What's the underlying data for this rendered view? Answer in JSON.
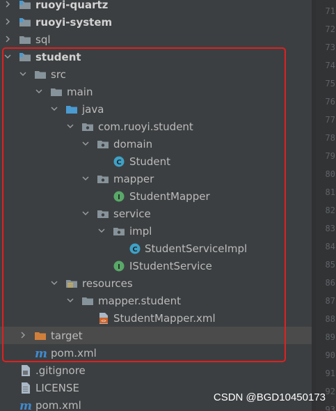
{
  "tree": {
    "items": [
      {
        "label": "ruoyi-quartz",
        "bold": true
      },
      {
        "label": "ruoyi-system",
        "bold": true
      },
      {
        "label": "sql"
      },
      {
        "label": "student",
        "bold": true
      },
      {
        "label": "src"
      },
      {
        "label": "main"
      },
      {
        "label": "java"
      },
      {
        "label": "com.ruoyi.student"
      },
      {
        "label": "domain"
      },
      {
        "label": "Student"
      },
      {
        "label": "mapper"
      },
      {
        "label": "StudentMapper"
      },
      {
        "label": "service"
      },
      {
        "label": "impl"
      },
      {
        "label": "StudentServiceImpl"
      },
      {
        "label": "IStudentService"
      },
      {
        "label": "resources"
      },
      {
        "label": "mapper.student"
      },
      {
        "label": "StudentMapper.xml"
      },
      {
        "label": "target"
      },
      {
        "label": "pom.xml"
      },
      {
        "label": ".gitignore"
      },
      {
        "label": "LICENSE"
      },
      {
        "label": "pom.xml"
      }
    ]
  },
  "gutter": {
    "line_numbers": [
      "71",
      "72",
      "73",
      "74",
      "75",
      "76",
      "77",
      "78",
      "79",
      "80",
      "81",
      "82",
      "83",
      "84",
      "85",
      "86",
      "87",
      "88",
      "89",
      "90",
      "91",
      "92",
      "93"
    ]
  },
  "watermark": "CSDN @BGD10450173",
  "colors": {
    "background": "#3c3f41",
    "text": "#bbbbbb",
    "folder": "#87939a",
    "source_folder": "#4a9bd1",
    "excluded_folder": "#d07f3b",
    "class_icon": "#3fa1c6",
    "interface_icon": "#59a869",
    "maven_icon": "#3f8bd0",
    "highlight": "#e02020"
  }
}
